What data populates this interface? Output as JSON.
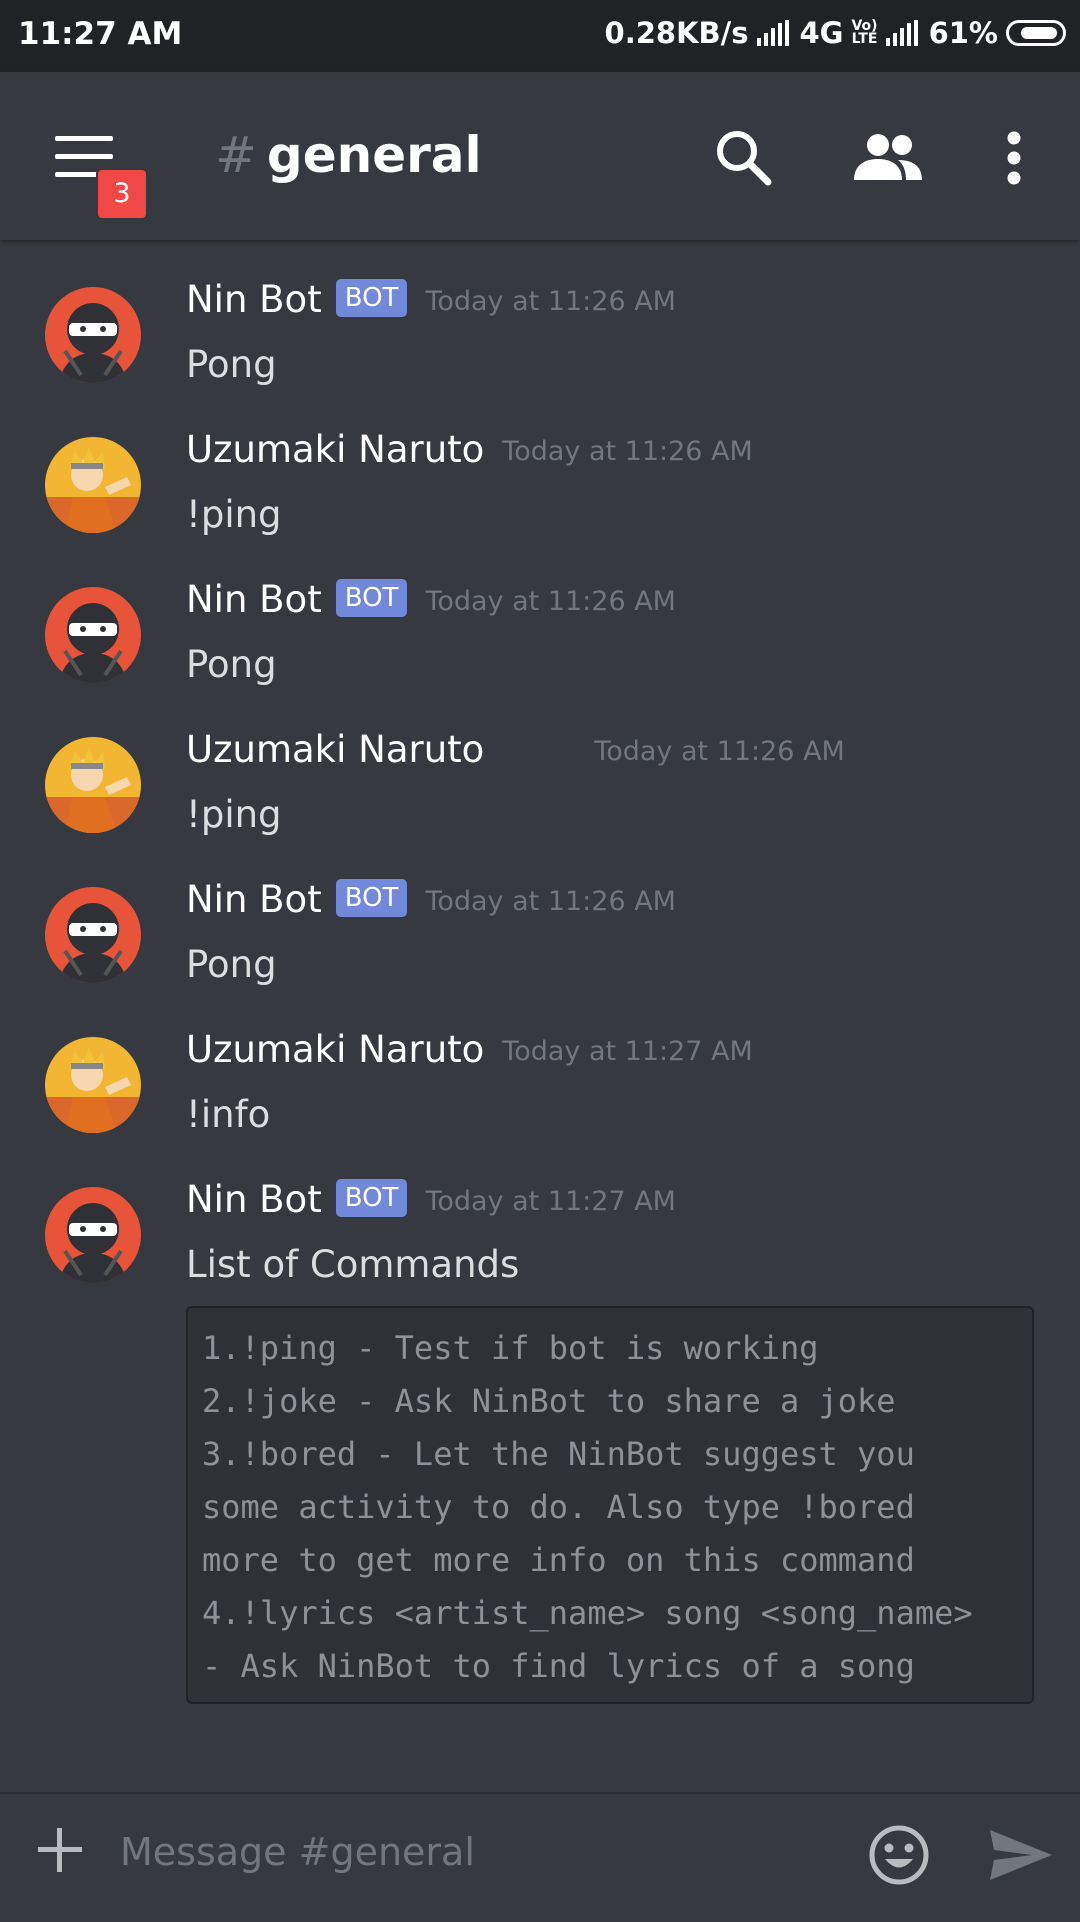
{
  "status_bar": {
    "time": "11:27 AM",
    "net_speed": "0.28KB/s",
    "network_type": "4G",
    "volte": [
      "Vo)",
      "LTE"
    ],
    "battery": "61%",
    "battery_level": 0.61
  },
  "header": {
    "menu_badge": "3",
    "channel_hash": "#",
    "channel_name": "general"
  },
  "messages": [
    {
      "author": "Nin Bot",
      "bot_tag": "BOT",
      "time": "Today at 11:26 AM",
      "text": "Pong",
      "avatar": "ninja-avatar"
    },
    {
      "author": "Uzumaki Naruto",
      "time": "Today at 11:26 AM",
      "text": "!ping",
      "avatar": "naruto-avatar"
    },
    {
      "author": "Nin Bot",
      "bot_tag": "BOT",
      "time": "Today at 11:26 AM",
      "text": "Pong",
      "avatar": "ninja-avatar"
    },
    {
      "author": "Uzumaki Naruto",
      "time": "Today at 11:26 AM",
      "text": "!ping",
      "avatar": "naruto-avatar"
    },
    {
      "author": "Nin Bot",
      "bot_tag": "BOT",
      "time": "Today at 11:26 AM",
      "text": "Pong",
      "avatar": "ninja-avatar"
    },
    {
      "author": "Uzumaki Naruto",
      "time": "Today at 11:27 AM",
      "text": "!info",
      "avatar": "naruto-avatar"
    },
    {
      "author": "Nin Bot",
      "bot_tag": "BOT",
      "time": "Today at 11:27 AM",
      "text": "List of Commands",
      "avatar": "ninja-avatar",
      "code_lines": [
        "1.!ping - Test if bot is working",
        "2.!joke - Ask NinBot to share a joke",
        "3.!bored - Let the NinBot suggest you",
        "some activity to do. Also type !bored",
        "more to get more info on this command",
        "4.!lyrics <artist_name> song <song_name>",
        "- Ask NinBot to find lyrics of a song"
      ]
    }
  ],
  "composer": {
    "placeholder": "Message #general"
  },
  "colors": {
    "background": "#36393f",
    "status_bar": "#202225",
    "bot_badge": "#7289da",
    "notification_badge": "#f04747",
    "ninja_avatar": "#e8543a"
  }
}
